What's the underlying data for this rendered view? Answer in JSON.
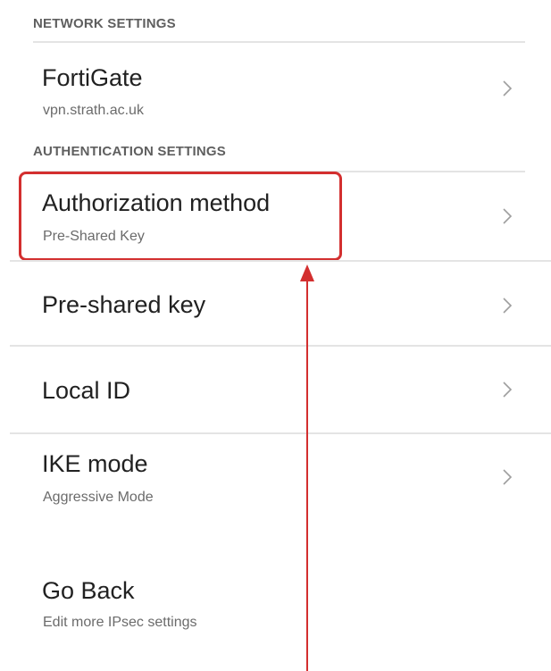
{
  "network_settings": {
    "header": "NETWORK SETTINGS",
    "items": [
      {
        "title": "FortiGate",
        "subtitle": "vpn.strath.ac.uk"
      }
    ]
  },
  "authentication_settings": {
    "header": "AUTHENTICATION SETTINGS",
    "items": [
      {
        "title": "Authorization method",
        "subtitle": "Pre-Shared Key"
      },
      {
        "title": "Pre-shared key"
      },
      {
        "title": "Local ID"
      },
      {
        "title": "IKE mode",
        "subtitle": "Aggressive Mode"
      }
    ]
  },
  "footer_item": {
    "title": "Go Back",
    "subtitle": "Edit more IPsec settings"
  },
  "icons": {
    "chevron": "chevron-right-icon",
    "annotation_arrow": "arrow-up-icon"
  },
  "colors": {
    "annotation": "#d32f2f",
    "divider": "#e4e4e4",
    "header_text": "#5f5f5f",
    "title_text": "#212121",
    "subtitle_text": "#6b6b6b"
  }
}
